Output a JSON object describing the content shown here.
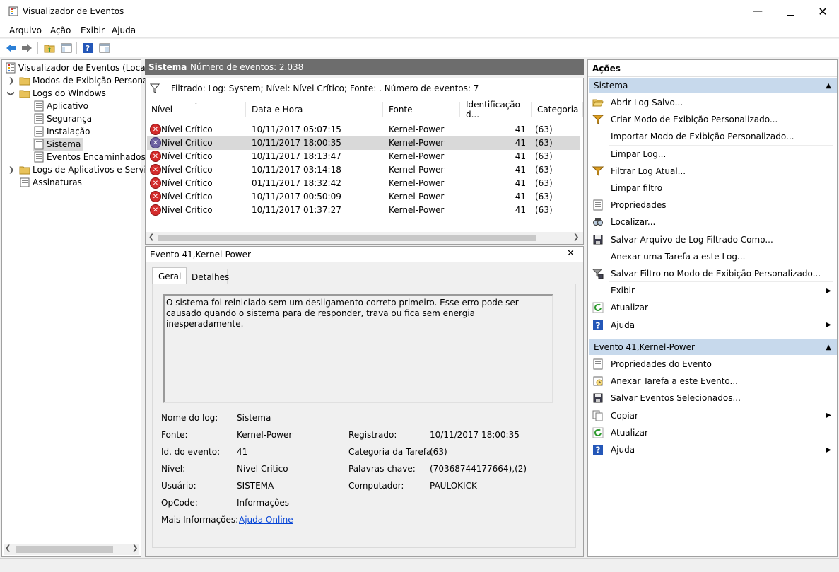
{
  "window": {
    "title": "Visualizador de Eventos"
  },
  "menu": [
    "Arquivo",
    "Ação",
    "Exibir",
    "Ajuda"
  ],
  "tree": {
    "root": "Visualizador de Eventos (Local)",
    "custom_views": "Modos de Exibição Personali",
    "windows_logs": "Logs do Windows",
    "logs": [
      "Aplicativo",
      "Segurança",
      "Instalação",
      "Sistema",
      "Eventos Encaminhados"
    ],
    "app_logs": "Logs de Aplicativos e Serviço",
    "subscriptions": "Assinaturas",
    "selected": "Sistema"
  },
  "center": {
    "header_title": "Sistema",
    "header_count": "Número de eventos: 2.038",
    "filter_text": "Filtrado: Log: System; Nível: Nível Crítico; Fonte: . Número de eventos: 7",
    "columns": [
      "Nível",
      "Data e Hora",
      "Fonte",
      "Identificação d...",
      "Categoria da"
    ],
    "rows": [
      {
        "level": "Nível Crítico",
        "date": "10/11/2017 05:07:15",
        "source": "Kernel-Power",
        "id": "41",
        "cat": "(63)"
      },
      {
        "level": "Nível Crítico",
        "date": "10/11/2017 18:00:35",
        "source": "Kernel-Power",
        "id": "41",
        "cat": "(63)"
      },
      {
        "level": "Nível Crítico",
        "date": "10/11/2017 18:13:47",
        "source": "Kernel-Power",
        "id": "41",
        "cat": "(63)"
      },
      {
        "level": "Nível Crítico",
        "date": "10/11/2017 03:14:18",
        "source": "Kernel-Power",
        "id": "41",
        "cat": "(63)"
      },
      {
        "level": "Nível Crítico",
        "date": "01/11/2017 18:32:42",
        "source": "Kernel-Power",
        "id": "41",
        "cat": "(63)"
      },
      {
        "level": "Nível Crítico",
        "date": "10/11/2017 00:50:09",
        "source": "Kernel-Power",
        "id": "41",
        "cat": "(63)"
      },
      {
        "level": "Nível Crítico",
        "date": "10/11/2017 01:37:27",
        "source": "Kernel-Power",
        "id": "41",
        "cat": "(63)"
      }
    ],
    "selected_row": 1
  },
  "detail": {
    "title": "Evento 41,Kernel-Power",
    "tabs": [
      "Geral",
      "Detalhes"
    ],
    "description": "O sistema foi reiniciado sem um desligamento correto primeiro. Esse erro pode ser causado quando o sistema para de responder, trava ou fica sem energia inesperadamente.",
    "fields": {
      "log_name_label": "Nome do log:",
      "log_name": "Sistema",
      "source_label": "Fonte:",
      "source": "Kernel-Power",
      "event_id_label": "Id. do evento:",
      "event_id": "41",
      "level_label": "Nível:",
      "level": "Nível Crítico",
      "user_label": "Usuário:",
      "user": "SISTEMA",
      "opcode_label": "OpCode:",
      "opcode": "Informações",
      "more_info_label": "Mais Informações:",
      "more_info_link": "Ajuda Online",
      "logged_label": "Registrado:",
      "logged": "10/11/2017 18:00:35",
      "task_label": "Categoria da Tarefa:",
      "task": "(63)",
      "keywords_label": "Palavras-chave:",
      "keywords": "(70368744177664),(2)",
      "computer_label": "Computador:",
      "computer": "PAULOKICK"
    }
  },
  "actions": {
    "title": "Ações",
    "section1": "Sistema",
    "items1": [
      {
        "label": "Abrir Log Salvo...",
        "icon": "folder-open-icon"
      },
      {
        "label": "Criar Modo de Exibição Personalizado...",
        "icon": "filter-icon"
      },
      {
        "label": "Importar Modo de Exibição Personalizado...",
        "icon": ""
      },
      {
        "label": "Limpar Log...",
        "icon": ""
      },
      {
        "label": "Filtrar Log Atual...",
        "icon": "filter-icon"
      },
      {
        "label": "Limpar filtro",
        "icon": ""
      },
      {
        "label": "Propriedades",
        "icon": "properties-icon"
      },
      {
        "label": "Localizar...",
        "icon": "find-icon"
      },
      {
        "label": "Salvar Arquivo de Log Filtrado Como...",
        "icon": "save-icon"
      },
      {
        "label": "Anexar uma Tarefa a este Log...",
        "icon": ""
      },
      {
        "label": "Salvar Filtro no Modo de Exibição Personalizado...",
        "icon": "filter-save-icon"
      },
      {
        "label": "Exibir",
        "icon": "",
        "submenu": true
      },
      {
        "label": "Atualizar",
        "icon": "refresh-icon"
      },
      {
        "label": "Ajuda",
        "icon": "help-icon",
        "submenu": true
      }
    ],
    "section2": "Evento 41,Kernel-Power",
    "items2": [
      {
        "label": "Propriedades do Evento",
        "icon": "properties-icon"
      },
      {
        "label": "Anexar Tarefa a este Evento...",
        "icon": "task-icon"
      },
      {
        "label": "Salvar Eventos Selecionados...",
        "icon": "save-icon"
      },
      {
        "label": "Copiar",
        "icon": "copy-icon",
        "submenu": true
      },
      {
        "label": "Atualizar",
        "icon": "refresh-icon"
      },
      {
        "label": "Ajuda",
        "icon": "help-icon",
        "submenu": true
      }
    ]
  }
}
